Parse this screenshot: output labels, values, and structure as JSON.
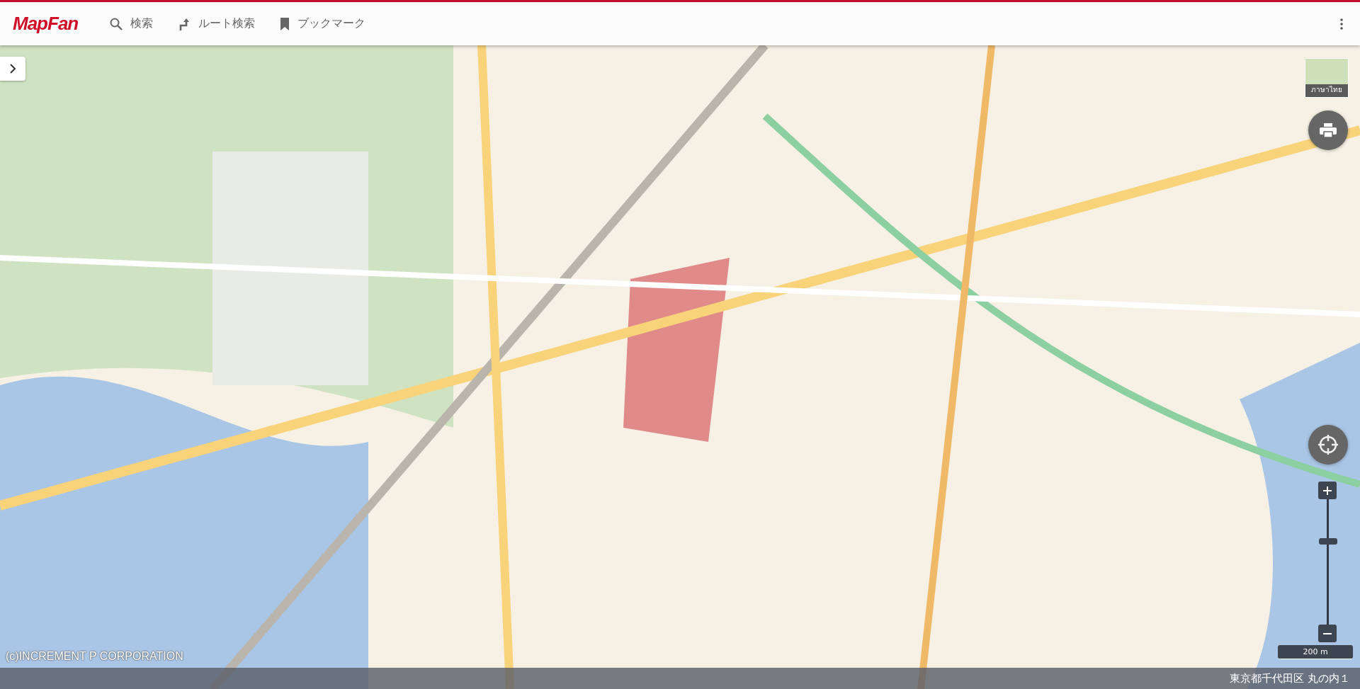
{
  "header": {
    "logo": "MapFan",
    "nav": [
      {
        "label": "検索",
        "kind": "search"
      },
      {
        "label": "ルート検索",
        "kind": "route"
      },
      {
        "label": "ブックマーク",
        "kind": "bookmark"
      }
    ]
  },
  "map": {
    "language_button": "ภาษาไทย",
    "copyright": "(c)INCREMENT P CORPORATION",
    "zoom": {
      "level": 0.66
    },
    "scale": "200 m"
  },
  "status_bar": {
    "address": "東京都千代田区 丸の内１"
  }
}
